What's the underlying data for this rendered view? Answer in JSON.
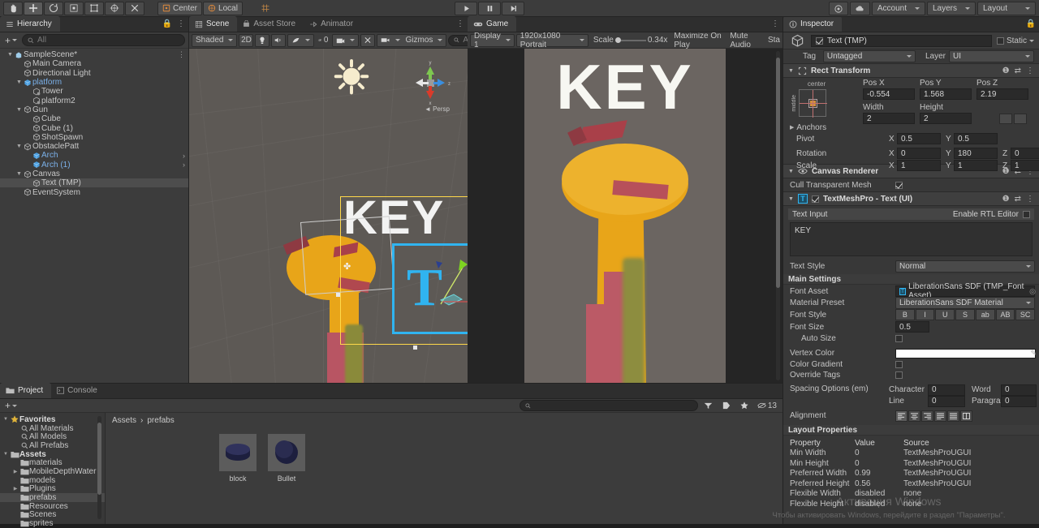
{
  "toolbar": {
    "tools": [
      {
        "name": "hand-tool",
        "icon": "✋"
      },
      {
        "name": "move-tool",
        "icon": "✥"
      },
      {
        "name": "rotate-tool",
        "icon": "⟳"
      },
      {
        "name": "scale-tool",
        "icon": "⤢"
      },
      {
        "name": "rect-tool",
        "icon": "▣"
      },
      {
        "name": "transform-tool",
        "icon": "✧"
      },
      {
        "name": "custom-tool",
        "icon": "✂"
      }
    ],
    "pivot_label": "Center",
    "space_label": "Local",
    "grid_label": "grid-snap",
    "play_label": "▶",
    "pause_label": "❚❚",
    "step_label": "▶❙",
    "account_label": "Account",
    "layers_label": "Layers",
    "layout_label": "Layout"
  },
  "hierarchy": {
    "tab_label": "Hierarchy",
    "search_placeholder": "All",
    "add_label": "+",
    "items": [
      {
        "label": "SampleScene*",
        "depth": 0,
        "arrow": "▼",
        "icon": "scene",
        "selected": false,
        "prefab": false,
        "more": true
      },
      {
        "label": "Main Camera",
        "depth": 1,
        "arrow": "",
        "icon": "go",
        "selected": false,
        "prefab": false
      },
      {
        "label": "Directional Light",
        "depth": 1,
        "arrow": "",
        "icon": "go",
        "selected": false,
        "prefab": false
      },
      {
        "label": "platform",
        "depth": 1,
        "arrow": "▼",
        "icon": "prefab",
        "selected": false,
        "prefab": true
      },
      {
        "label": "Tower",
        "depth": 2,
        "arrow": "",
        "icon": "prefabchild",
        "selected": false,
        "prefab": false
      },
      {
        "label": "platform2",
        "depth": 2,
        "arrow": "",
        "icon": "prefabchild",
        "selected": false,
        "prefab": false
      },
      {
        "label": "Gun",
        "depth": 1,
        "arrow": "▼",
        "icon": "go",
        "selected": false,
        "prefab": false
      },
      {
        "label": "Cube",
        "depth": 2,
        "arrow": "",
        "icon": "go",
        "selected": false,
        "prefab": false
      },
      {
        "label": "Cube (1)",
        "depth": 2,
        "arrow": "",
        "icon": "go",
        "selected": false,
        "prefab": false
      },
      {
        "label": "ShotSpawn",
        "depth": 2,
        "arrow": "",
        "icon": "go",
        "selected": false,
        "prefab": false
      },
      {
        "label": "ObstaclePatt",
        "depth": 1,
        "arrow": "▼",
        "icon": "go",
        "selected": false,
        "prefab": false
      },
      {
        "label": "Arch",
        "depth": 2,
        "arrow": "",
        "icon": "prefab",
        "selected": false,
        "prefab": true,
        "chevron": true
      },
      {
        "label": "Arch (1)",
        "depth": 2,
        "arrow": "",
        "icon": "prefab",
        "selected": false,
        "prefab": true,
        "chevron": true
      },
      {
        "label": "Canvas",
        "depth": 1,
        "arrow": "▼",
        "icon": "go",
        "selected": false,
        "prefab": false
      },
      {
        "label": "Text (TMP)",
        "depth": 2,
        "arrow": "",
        "icon": "go",
        "selected": true,
        "prefab": false
      },
      {
        "label": "EventSystem",
        "depth": 1,
        "arrow": "",
        "icon": "go",
        "selected": false,
        "prefab": false
      }
    ]
  },
  "scene": {
    "tabs": [
      {
        "label": "Scene",
        "active": true,
        "icon": "grid-icon"
      },
      {
        "label": "Asset Store",
        "active": false,
        "icon": "store-icon"
      },
      {
        "label": "Animator",
        "active": false,
        "icon": "animator-icon"
      }
    ],
    "shading_mode": "Shaded",
    "mode_2d": "2D",
    "gizmos_label": "Gizmos",
    "effects_count": "0",
    "search_placeholder": "A",
    "persp_label": "Persp",
    "axis_x": "x",
    "axis_y": "y",
    "axis_z": "z",
    "overlay_text": "KEY"
  },
  "game": {
    "tab_label": "Game",
    "display_label": "Display 1",
    "resolution_label": "1920x1080 Portrait",
    "scale_label": "Scale",
    "scale_value": "0.34x",
    "maximize_label": "Maximize On Play",
    "mute_label": "Mute Audio",
    "stats_label": "Sta",
    "render_text": "KEY"
  },
  "inspector": {
    "tab_label": "Inspector",
    "object_name": "Text (TMP)",
    "object_enabled": true,
    "static_label": "Static",
    "tag_label": "Tag",
    "tag_value": "Untagged",
    "layer_label": "Layer",
    "layer_value": "UI",
    "rect_transform": {
      "title": "Rect Transform",
      "anchor_preset_top": "center",
      "anchor_preset_side": "middle",
      "headers": [
        "Pos X",
        "Pos Y",
        "Pos Z"
      ],
      "pos": [
        "-0.554",
        "1.568",
        "2.19"
      ],
      "size_headers": [
        "Width",
        "Height"
      ],
      "size": [
        "2",
        "2"
      ],
      "anchors_label": "Anchors",
      "pivot_label": "Pivot",
      "pivot": [
        "0.5",
        "0.5"
      ],
      "rotation_label": "Rotation",
      "rotation": [
        "0",
        "180",
        "0"
      ],
      "scale_label": "Scale",
      "scale": [
        "1",
        "1",
        "1"
      ],
      "axes": [
        "X",
        "Y",
        "Z"
      ]
    },
    "canvas_renderer": {
      "title": "Canvas Renderer",
      "cull_label": "Cull Transparent Mesh",
      "cull_checked": true
    },
    "tmp": {
      "title": "TextMeshPro - Text (UI)",
      "enabled": true,
      "text_input_label": "Text Input",
      "rtl_label": "Enable RTL Editor",
      "rtl_checked": false,
      "text_value": "KEY",
      "text_style_label": "Text Style",
      "text_style_value": "Normal",
      "main_settings_label": "Main Settings",
      "font_asset_label": "Font Asset",
      "font_asset_value": "LiberationSans SDF (TMP_Font Asset)",
      "material_preset_label": "Material Preset",
      "material_preset_value": "LiberationSans SDF Material",
      "font_style_label": "Font Style",
      "font_style_buttons": [
        "B",
        "I",
        "U",
        "S",
        "ab",
        "AB",
        "SC"
      ],
      "font_size_label": "Font Size",
      "font_size_value": "0.5",
      "auto_size_label": "Auto Size",
      "auto_size_checked": false,
      "vertex_color_label": "Vertex Color",
      "vertex_color_value": "#FFFFFF",
      "color_gradient_label": "Color Gradient",
      "color_gradient_checked": false,
      "override_tags_label": "Override Tags",
      "override_tags_checked": false,
      "spacing_label": "Spacing Options (em)",
      "spacing_character_label": "Character",
      "spacing_character": "0",
      "spacing_word_label": "Word",
      "spacing_word": "0",
      "spacing_line_label": "Line",
      "spacing_line": "0",
      "spacing_paragraph_label": "Paragraph",
      "spacing_paragraph": "0",
      "alignment_label": "Alignment"
    },
    "layout_properties": {
      "title": "Layout Properties",
      "headers": [
        "Property",
        "Value",
        "Source"
      ],
      "rows": [
        {
          "property": "Min Width",
          "value": "0",
          "source": "TextMeshProUGUI"
        },
        {
          "property": "Min Height",
          "value": "0",
          "source": "TextMeshProUGUI"
        },
        {
          "property": "Preferred Width",
          "value": "0.99",
          "source": "TextMeshProUGUI"
        },
        {
          "property": "Preferred Height",
          "value": "0.56",
          "source": "TextMeshProUGUI"
        },
        {
          "property": "Flexible Width",
          "value": "disabled",
          "source": "none"
        },
        {
          "property": "Flexible Height",
          "value": "disabled",
          "source": "none"
        }
      ]
    }
  },
  "project": {
    "tabs": [
      {
        "label": "Project",
        "active": true
      },
      {
        "label": "Console",
        "active": false
      }
    ],
    "add_label": "+",
    "search_placeholder": "",
    "badge_count": "13",
    "breadcrumb": [
      "Assets",
      "prefabs"
    ],
    "tree": [
      {
        "label": "Favorites",
        "depth": 0,
        "arrow": "▼",
        "icon": "star",
        "selected": false
      },
      {
        "label": "All Materials",
        "depth": 1,
        "arrow": "",
        "icon": "search",
        "selected": false
      },
      {
        "label": "All Models",
        "depth": 1,
        "arrow": "",
        "icon": "search",
        "selected": false
      },
      {
        "label": "All Prefabs",
        "depth": 1,
        "arrow": "",
        "icon": "search",
        "selected": false
      },
      {
        "label": "Assets",
        "depth": 0,
        "arrow": "▼",
        "icon": "folder",
        "selected": false
      },
      {
        "label": "materials",
        "depth": 1,
        "arrow": "",
        "icon": "folder",
        "selected": false
      },
      {
        "label": "MobileDepthWater",
        "depth": 1,
        "arrow": "▶",
        "icon": "folder",
        "selected": false
      },
      {
        "label": "models",
        "depth": 1,
        "arrow": "",
        "icon": "folder",
        "selected": false
      },
      {
        "label": "Plugins",
        "depth": 1,
        "arrow": "▶",
        "icon": "folder",
        "selected": false
      },
      {
        "label": "prefabs",
        "depth": 1,
        "arrow": "",
        "icon": "folder",
        "selected": true
      },
      {
        "label": "Resources",
        "depth": 1,
        "arrow": "",
        "icon": "folder",
        "selected": false
      },
      {
        "label": "Scenes",
        "depth": 1,
        "arrow": "",
        "icon": "folder",
        "selected": false
      },
      {
        "label": "sprites",
        "depth": 1,
        "arrow": "",
        "icon": "folder",
        "selected": false
      }
    ],
    "assets": [
      {
        "name": "block",
        "shape": "cylinder"
      },
      {
        "name": "Bullet",
        "shape": "sphere"
      }
    ]
  },
  "watermark": {
    "line1": "Активация Windows",
    "line2": "Чтобы активировать Windows, перейдите в раздел \"Параметры\"."
  },
  "colors": {
    "accent_blue": "#30b4f0",
    "select_yellow": "#ffd94a",
    "tower_yellow": "#e8a519",
    "tower_red": "#b04a4a",
    "bg_panel": "#383838",
    "bg_dark": "#2e2e2e"
  }
}
